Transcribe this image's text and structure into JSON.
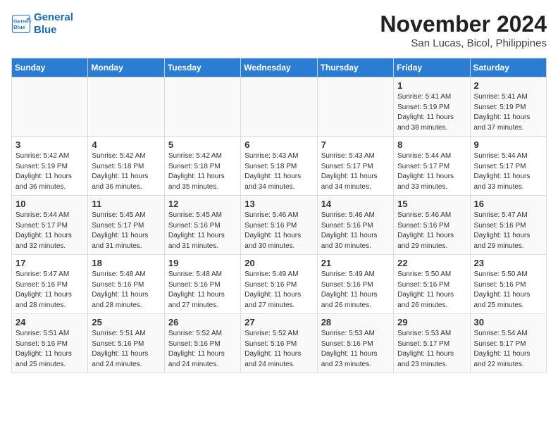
{
  "header": {
    "logo_line1": "General",
    "logo_line2": "Blue",
    "month_year": "November 2024",
    "location": "San Lucas, Bicol, Philippines"
  },
  "weekdays": [
    "Sunday",
    "Monday",
    "Tuesday",
    "Wednesday",
    "Thursday",
    "Friday",
    "Saturday"
  ],
  "weeks": [
    [
      {
        "day": "",
        "info": ""
      },
      {
        "day": "",
        "info": ""
      },
      {
        "day": "",
        "info": ""
      },
      {
        "day": "",
        "info": ""
      },
      {
        "day": "",
        "info": ""
      },
      {
        "day": "1",
        "info": "Sunrise: 5:41 AM\nSunset: 5:19 PM\nDaylight: 11 hours\nand 38 minutes."
      },
      {
        "day": "2",
        "info": "Sunrise: 5:41 AM\nSunset: 5:19 PM\nDaylight: 11 hours\nand 37 minutes."
      }
    ],
    [
      {
        "day": "3",
        "info": "Sunrise: 5:42 AM\nSunset: 5:19 PM\nDaylight: 11 hours\nand 36 minutes."
      },
      {
        "day": "4",
        "info": "Sunrise: 5:42 AM\nSunset: 5:18 PM\nDaylight: 11 hours\nand 36 minutes."
      },
      {
        "day": "5",
        "info": "Sunrise: 5:42 AM\nSunset: 5:18 PM\nDaylight: 11 hours\nand 35 minutes."
      },
      {
        "day": "6",
        "info": "Sunrise: 5:43 AM\nSunset: 5:18 PM\nDaylight: 11 hours\nand 34 minutes."
      },
      {
        "day": "7",
        "info": "Sunrise: 5:43 AM\nSunset: 5:17 PM\nDaylight: 11 hours\nand 34 minutes."
      },
      {
        "day": "8",
        "info": "Sunrise: 5:44 AM\nSunset: 5:17 PM\nDaylight: 11 hours\nand 33 minutes."
      },
      {
        "day": "9",
        "info": "Sunrise: 5:44 AM\nSunset: 5:17 PM\nDaylight: 11 hours\nand 33 minutes."
      }
    ],
    [
      {
        "day": "10",
        "info": "Sunrise: 5:44 AM\nSunset: 5:17 PM\nDaylight: 11 hours\nand 32 minutes."
      },
      {
        "day": "11",
        "info": "Sunrise: 5:45 AM\nSunset: 5:17 PM\nDaylight: 11 hours\nand 31 minutes."
      },
      {
        "day": "12",
        "info": "Sunrise: 5:45 AM\nSunset: 5:16 PM\nDaylight: 11 hours\nand 31 minutes."
      },
      {
        "day": "13",
        "info": "Sunrise: 5:46 AM\nSunset: 5:16 PM\nDaylight: 11 hours\nand 30 minutes."
      },
      {
        "day": "14",
        "info": "Sunrise: 5:46 AM\nSunset: 5:16 PM\nDaylight: 11 hours\nand 30 minutes."
      },
      {
        "day": "15",
        "info": "Sunrise: 5:46 AM\nSunset: 5:16 PM\nDaylight: 11 hours\nand 29 minutes."
      },
      {
        "day": "16",
        "info": "Sunrise: 5:47 AM\nSunset: 5:16 PM\nDaylight: 11 hours\nand 29 minutes."
      }
    ],
    [
      {
        "day": "17",
        "info": "Sunrise: 5:47 AM\nSunset: 5:16 PM\nDaylight: 11 hours\nand 28 minutes."
      },
      {
        "day": "18",
        "info": "Sunrise: 5:48 AM\nSunset: 5:16 PM\nDaylight: 11 hours\nand 28 minutes."
      },
      {
        "day": "19",
        "info": "Sunrise: 5:48 AM\nSunset: 5:16 PM\nDaylight: 11 hours\nand 27 minutes."
      },
      {
        "day": "20",
        "info": "Sunrise: 5:49 AM\nSunset: 5:16 PM\nDaylight: 11 hours\nand 27 minutes."
      },
      {
        "day": "21",
        "info": "Sunrise: 5:49 AM\nSunset: 5:16 PM\nDaylight: 11 hours\nand 26 minutes."
      },
      {
        "day": "22",
        "info": "Sunrise: 5:50 AM\nSunset: 5:16 PM\nDaylight: 11 hours\nand 26 minutes."
      },
      {
        "day": "23",
        "info": "Sunrise: 5:50 AM\nSunset: 5:16 PM\nDaylight: 11 hours\nand 25 minutes."
      }
    ],
    [
      {
        "day": "24",
        "info": "Sunrise: 5:51 AM\nSunset: 5:16 PM\nDaylight: 11 hours\nand 25 minutes."
      },
      {
        "day": "25",
        "info": "Sunrise: 5:51 AM\nSunset: 5:16 PM\nDaylight: 11 hours\nand 24 minutes."
      },
      {
        "day": "26",
        "info": "Sunrise: 5:52 AM\nSunset: 5:16 PM\nDaylight: 11 hours\nand 24 minutes."
      },
      {
        "day": "27",
        "info": "Sunrise: 5:52 AM\nSunset: 5:16 PM\nDaylight: 11 hours\nand 24 minutes."
      },
      {
        "day": "28",
        "info": "Sunrise: 5:53 AM\nSunset: 5:16 PM\nDaylight: 11 hours\nand 23 minutes."
      },
      {
        "day": "29",
        "info": "Sunrise: 5:53 AM\nSunset: 5:17 PM\nDaylight: 11 hours\nand 23 minutes."
      },
      {
        "day": "30",
        "info": "Sunrise: 5:54 AM\nSunset: 5:17 PM\nDaylight: 11 hours\nand 22 minutes."
      }
    ]
  ]
}
